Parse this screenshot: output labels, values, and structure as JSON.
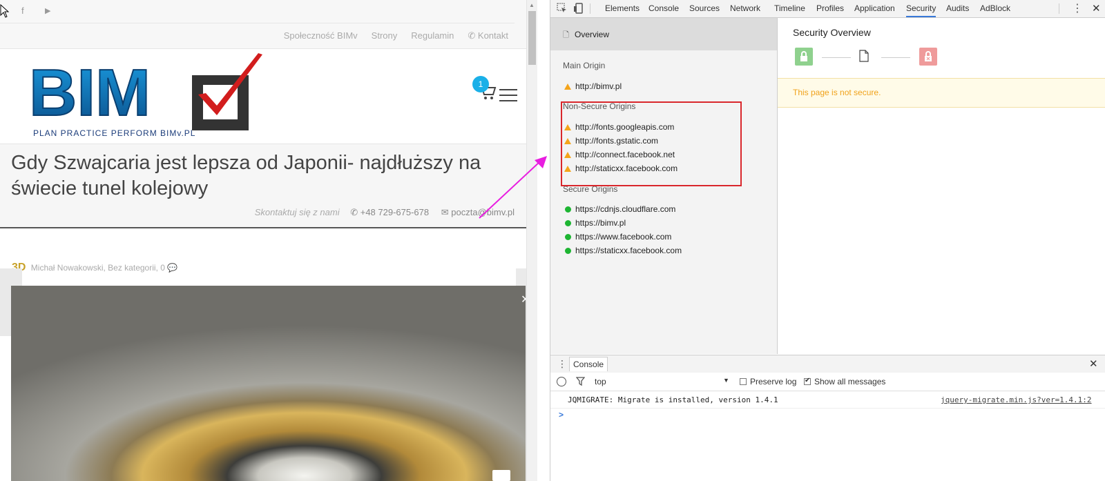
{
  "site": {
    "nav": [
      "Społeczność BIMv",
      "Strony",
      "Regulamin",
      "Kontakt"
    ],
    "logo": {
      "text": "BIM",
      "tagline": "PLAN PRACTICE PERFORM BIMv.PL"
    },
    "cart_count": "1",
    "page_title": "Gdy Szwajcaria jest lepsza od Japonii- najdłuższy na świecie tunel kolejowy",
    "contact": {
      "prompt": "Skontaktuj się z nami",
      "phone": "+48 729-675-678",
      "email": "poczta@bimv.pl"
    },
    "meta": {
      "badge": "3D",
      "author": "Michał Nowakowski",
      "category": "Bez kategorii",
      "comments": "0"
    }
  },
  "devtools": {
    "tabs": [
      "Elements",
      "Console",
      "Sources",
      "Network",
      "Timeline",
      "Profiles",
      "Application",
      "Security",
      "Audits",
      "AdBlock"
    ],
    "active_tab": "Security",
    "sidebar": {
      "overview": "Overview",
      "main_origin_heading": "Main Origin",
      "main_origin": "http://bimv.pl",
      "non_secure_heading": "Non-Secure Origins",
      "non_secure": [
        "http://fonts.googleapis.com",
        "http://fonts.gstatic.com",
        "http://connect.facebook.net",
        "http://staticxx.facebook.com"
      ],
      "secure_heading": "Secure Origins",
      "secure": [
        "https://cdnjs.cloudflare.com",
        "https://bimv.pl",
        "https://www.facebook.com",
        "https://staticxx.facebook.com"
      ]
    },
    "overview": {
      "title": "Security Overview",
      "status": "This page is not secure."
    },
    "console": {
      "tab": "Console",
      "context": "top",
      "preserve_log": "Preserve log",
      "show_all": "Show all messages",
      "message": "JQMIGRATE: Migrate is installed, version 1.4.1",
      "source": "jquery-migrate.min.js?ver=1.4.1:2",
      "prompt": ">"
    }
  },
  "colors": {
    "accent": "#3879d9",
    "warning": "#f4a41a",
    "secure": "#1db532",
    "insecure_text": "#f0a21b",
    "highlight_box": "#d9262b",
    "arrow": "#e81ee0"
  }
}
